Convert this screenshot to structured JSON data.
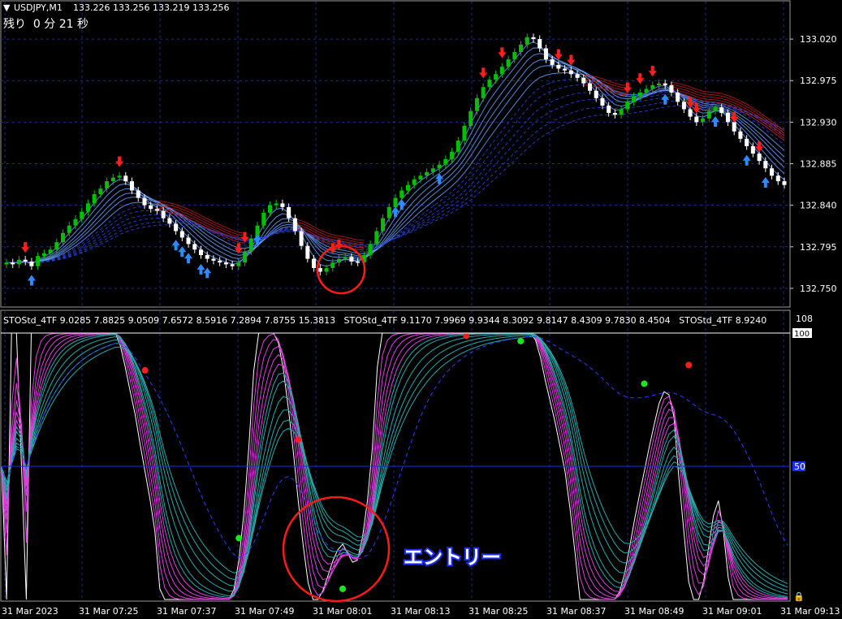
{
  "header": {
    "symbol": "USDJPY,M1",
    "quote": "133.226 133.256 133.219 133.256",
    "timer": "残り  0 分 21 秒"
  },
  "indicator": {
    "title": "STOStd_4TF 9.0285 7.8825 9.0509 7.6572 8.5916 7.2894 7.8755 15.3813   STOStd_4TF 9.1170 7.9969 9.9344 8.3092 9.8147 8.4309 9.7830 8.4504   STOStd_4TF 8.9240",
    "level_top": "108",
    "level_100": "100",
    "level_50": "50"
  },
  "annotation": {
    "entry_label": "エントリー"
  },
  "colors": {
    "bull": "#00c000",
    "bear": "#ffffff",
    "up_arrow": "#2a8cff",
    "down_arrow": "#ff1e1e",
    "grid": "#1c2e88",
    "stoch_main": "#ffffff",
    "stoch_fast": "#e040e0",
    "stoch_slow": "#2aaaaa",
    "entry_circle": "#ff1a1a",
    "mid_line": "#1a2cff"
  },
  "chart_data": [
    {
      "type": "candlestick",
      "title": "USDJPY,M1",
      "y_ticks": [
        "133.020",
        "132.975",
        "132.930",
        "132.885",
        "132.840",
        "132.795",
        "132.750"
      ],
      "ylim": [
        132.735,
        133.05
      ],
      "x_ticks": [
        "31 Mar 2023",
        "31 Mar 07:25",
        "31 Mar 07:37",
        "31 Mar 07:49",
        "31 Mar 08:01",
        "31 Mar 08:13",
        "31 Mar 08:25",
        "31 Mar 08:37",
        "31 Mar 08:49",
        "31 Mar 09:01",
        "31 Mar 09:13"
      ],
      "close": [
        132.778,
        132.776,
        132.781,
        132.779,
        132.774,
        132.785,
        132.788,
        132.792,
        132.8,
        132.81,
        132.818,
        132.825,
        132.833,
        132.842,
        132.852,
        132.858,
        132.866,
        132.87,
        132.872,
        132.866,
        132.856,
        132.848,
        132.84,
        132.836,
        132.834,
        132.826,
        132.82,
        132.812,
        132.805,
        132.798,
        132.792,
        132.786,
        132.782,
        132.78,
        132.778,
        132.776,
        132.774,
        132.778,
        132.79,
        132.804,
        132.818,
        132.832,
        132.84,
        132.842,
        132.838,
        132.826,
        132.812,
        132.796,
        132.782,
        132.772,
        132.768,
        132.772,
        132.778,
        132.782,
        132.784,
        132.779,
        132.778,
        132.786,
        132.798,
        132.812,
        132.826,
        132.838,
        132.848,
        132.856,
        132.862,
        132.868,
        132.872,
        132.876,
        132.88,
        132.884,
        132.89,
        132.898,
        132.91,
        132.926,
        132.942,
        132.956,
        132.968,
        132.976,
        132.982,
        132.99,
        132.998,
        133.006,
        133.014,
        133.022,
        133.02,
        133.01,
        132.998,
        132.992,
        132.988,
        132.986,
        132.982,
        132.978,
        132.972,
        132.964,
        132.956,
        132.948,
        132.94,
        132.938,
        132.944,
        132.952,
        132.958,
        132.962,
        132.966,
        132.97,
        132.972,
        132.97,
        132.962,
        132.952,
        132.944,
        132.936,
        132.93,
        132.934,
        132.942,
        132.946,
        132.94,
        132.93,
        132.92,
        132.912,
        132.904,
        132.896,
        132.888,
        132.88,
        132.872,
        132.866,
        132.862
      ],
      "up_arrows": [
        4,
        27,
        28,
        29,
        31,
        32,
        40,
        62,
        63,
        69,
        105,
        113,
        118,
        121
      ],
      "down_arrows": [
        3,
        18,
        37,
        38,
        52,
        53,
        76,
        79,
        88,
        90,
        99,
        101,
        103,
        109,
        110,
        116,
        120
      ],
      "xlabel": "",
      "ylabel": ""
    },
    {
      "type": "line",
      "title": "STOStd_4TF",
      "ylim": [
        0,
        100
      ],
      "levels": [
        100,
        50
      ],
      "series": [],
      "red_dots": [
        {
          "x": 29,
          "y": 86
        },
        {
          "x": 60,
          "y": 60
        },
        {
          "x": 94,
          "y": 99
        },
        {
          "x": 139,
          "y": 88
        }
      ],
      "green_dots": [
        {
          "x": 48,
          "y": 23
        },
        {
          "x": 69,
          "y": 4
        },
        {
          "x": 105,
          "y": 97
        },
        {
          "x": 130,
          "y": 81
        }
      ]
    }
  ]
}
